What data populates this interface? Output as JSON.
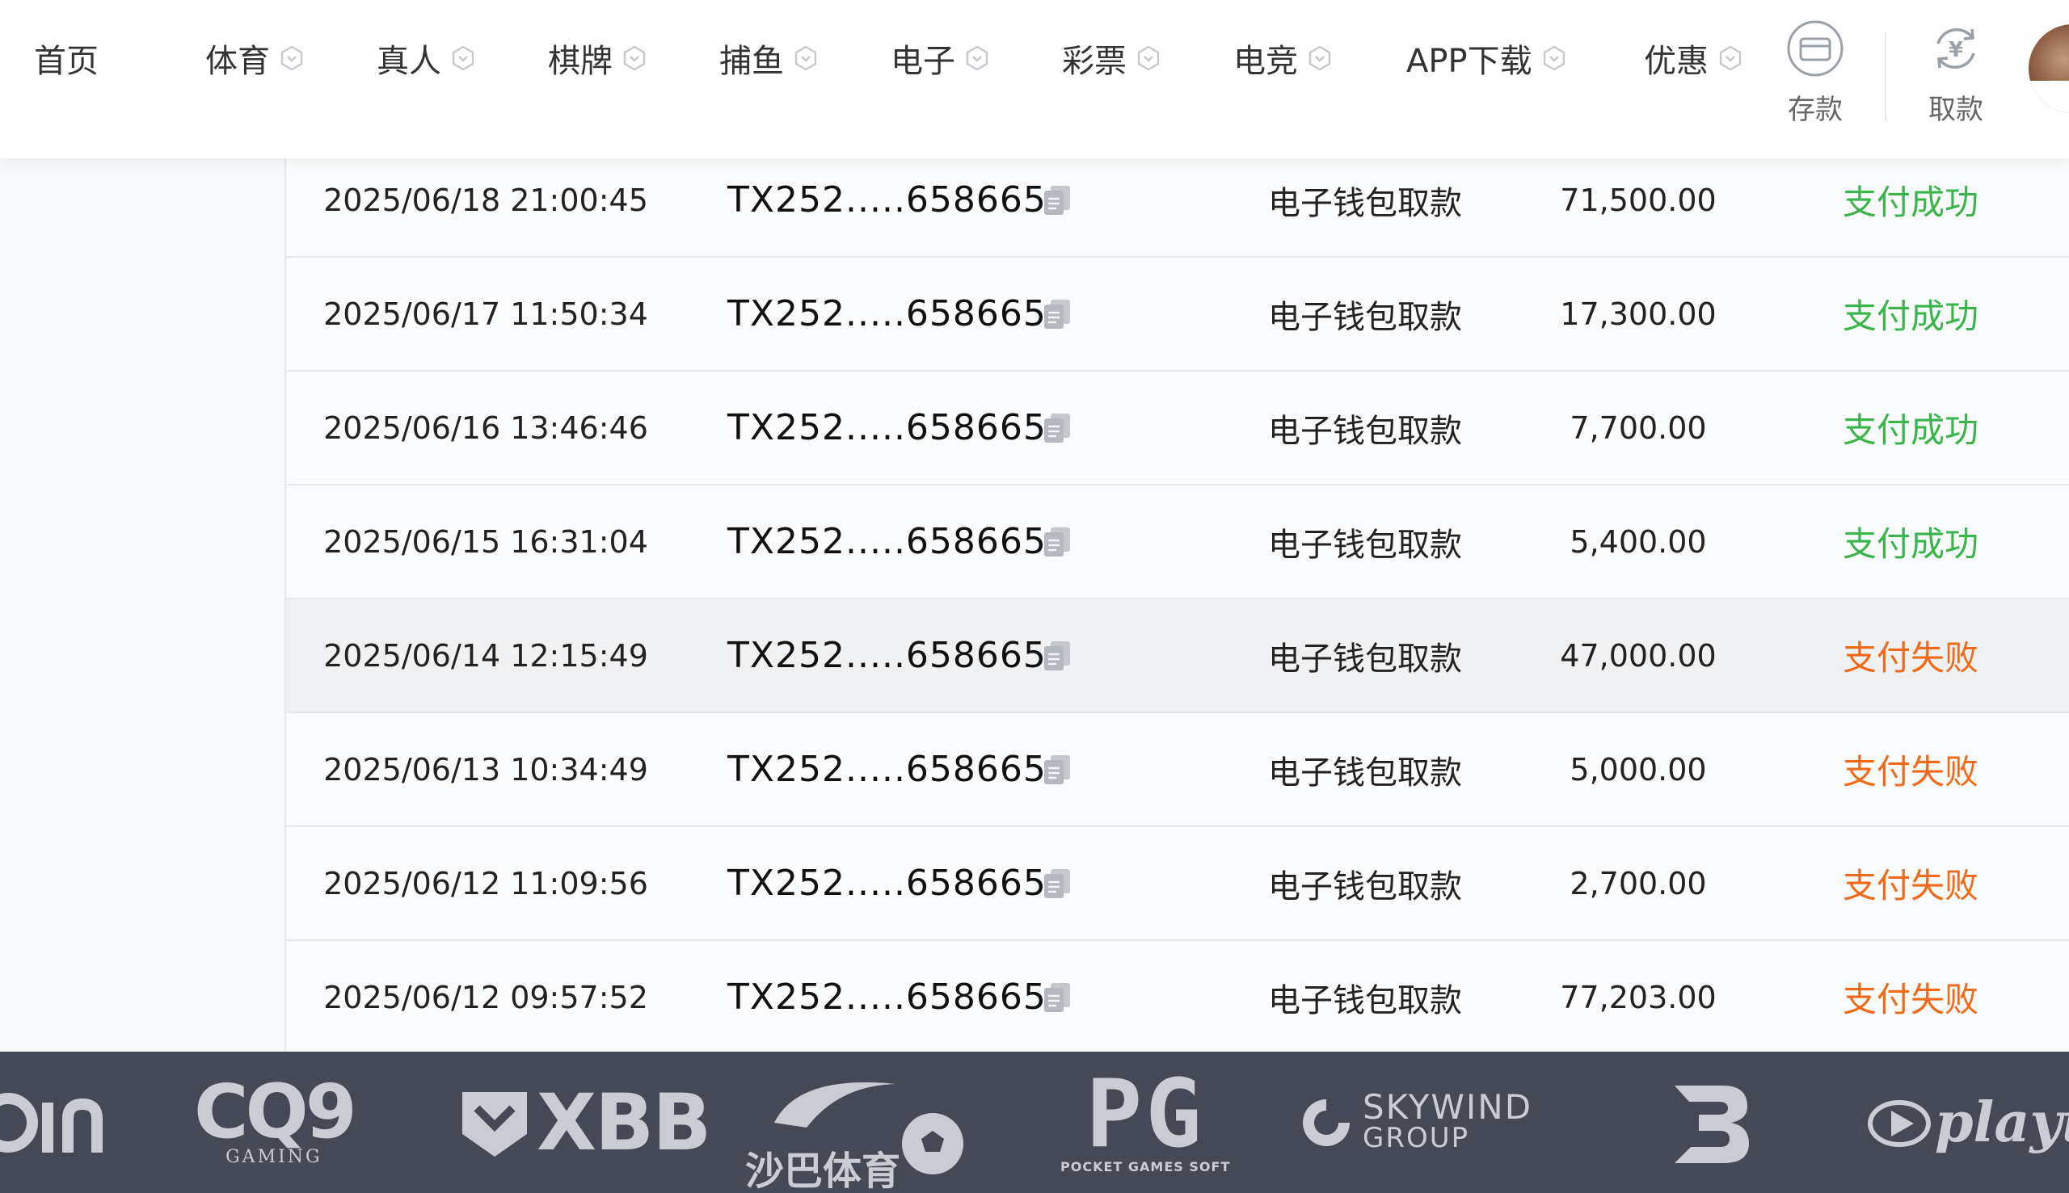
{
  "nav": {
    "items": [
      {
        "label": "首页",
        "has_chevron": false
      },
      {
        "label": "体育",
        "has_chevron": true
      },
      {
        "label": "真人",
        "has_chevron": true
      },
      {
        "label": "棋牌",
        "has_chevron": true
      },
      {
        "label": "捕鱼",
        "has_chevron": true
      },
      {
        "label": "电子",
        "has_chevron": true
      },
      {
        "label": "彩票",
        "has_chevron": true
      },
      {
        "label": "电竞",
        "has_chevron": true
      },
      {
        "label": "APP下载",
        "has_chevron": true
      },
      {
        "label": "优惠",
        "has_chevron": true
      }
    ],
    "deposit_label": "存款",
    "withdraw_label": "取款",
    "deposit_icon": "card-icon",
    "withdraw_icon": "yen-refresh-icon"
  },
  "records": [
    {
      "datetime": "2025/06/18 21:00:45",
      "order_id": "TX252.....658665",
      "type": "电子钱包取款",
      "amount": "71,500.00",
      "status": "支付成功",
      "status_kind": "success"
    },
    {
      "datetime": "2025/06/17 11:50:34",
      "order_id": "TX252.....658665",
      "type": "电子钱包取款",
      "amount": "17,300.00",
      "status": "支付成功",
      "status_kind": "success"
    },
    {
      "datetime": "2025/06/16 13:46:46",
      "order_id": "TX252.....658665",
      "type": "电子钱包取款",
      "amount": "7,700.00",
      "status": "支付成功",
      "status_kind": "success"
    },
    {
      "datetime": "2025/06/15 16:31:04",
      "order_id": "TX252.....658665",
      "type": "电子钱包取款",
      "amount": "5,400.00",
      "status": "支付成功",
      "status_kind": "success"
    },
    {
      "datetime": "2025/06/14 12:15:49",
      "order_id": "TX252.....658665",
      "type": "电子钱包取款",
      "amount": "47,000.00",
      "status": "支付失败",
      "status_kind": "fail"
    },
    {
      "datetime": "2025/06/13 10:34:49",
      "order_id": "TX252.....658665",
      "type": "电子钱包取款",
      "amount": "5,000.00",
      "status": "支付失败",
      "status_kind": "fail"
    },
    {
      "datetime": "2025/06/12 11:09:56",
      "order_id": "TX252.....658665",
      "type": "电子钱包取款",
      "amount": "2,700.00",
      "status": "支付失败",
      "status_kind": "fail"
    },
    {
      "datetime": "2025/06/12 09:57:52",
      "order_id": "TX252.....658665",
      "type": "电子钱包取款",
      "amount": "77,203.00",
      "status": "支付失败",
      "status_kind": "fail"
    }
  ],
  "colors": {
    "success": "#3ab54a",
    "fail": "#f06a1a",
    "footer_bg": "#444955"
  },
  "partners": {
    "cq9": "CQ9",
    "cq9_sub": "GAMING",
    "xbb": "XBB",
    "saba": "沙巴体育",
    "pg": "PG",
    "pg_sub": "POCKET GAMES SOFT",
    "skywind": "SKYWIND",
    "skywind_sub": "GROUP",
    "playtech": "playtec"
  }
}
